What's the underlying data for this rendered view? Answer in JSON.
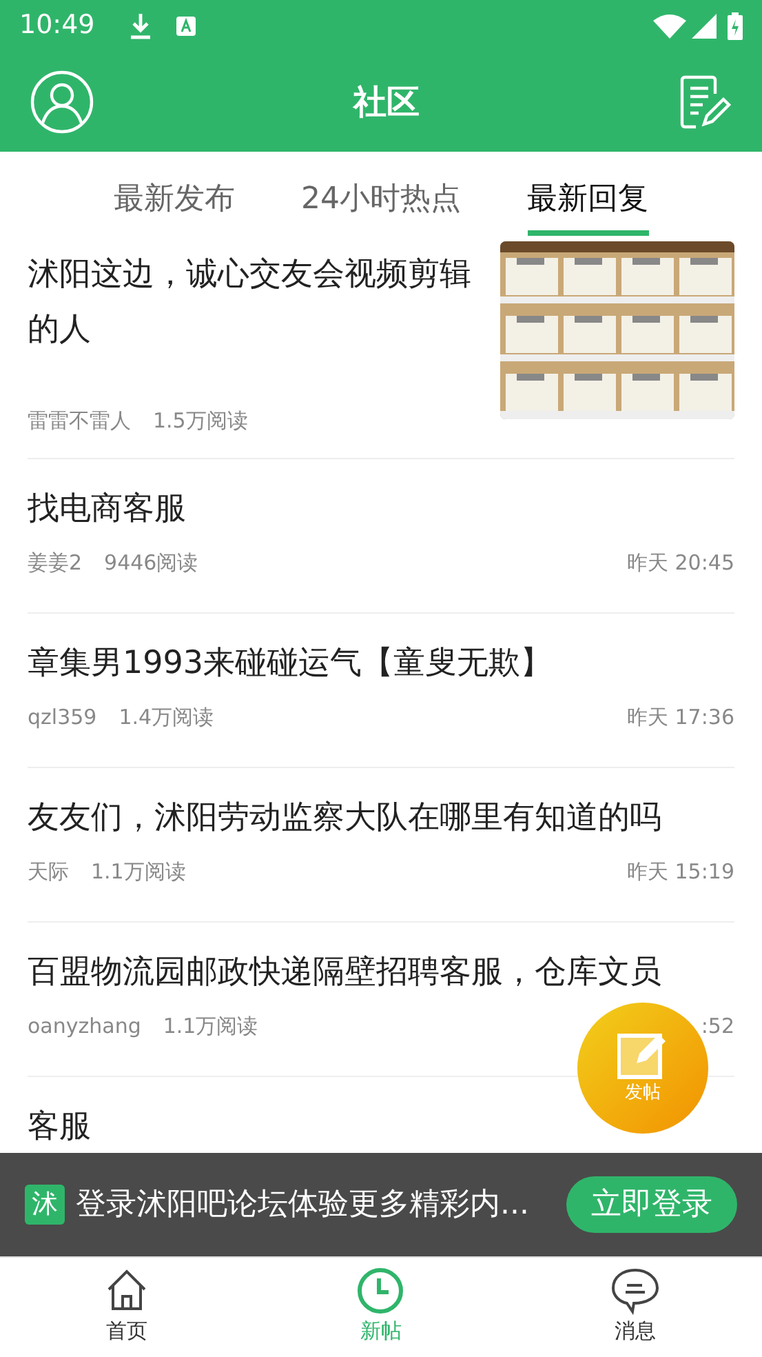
{
  "status_bar": {
    "time": "10:49"
  },
  "header": {
    "title": "社区"
  },
  "tabs": [
    {
      "label": "最新发布",
      "selected": false
    },
    {
      "label": "24小时热点",
      "selected": false
    },
    {
      "label": "最新回复",
      "selected": true
    }
  ],
  "posts": [
    {
      "title": "沭阳这边，诚心交友会视频剪辑的人",
      "author": "雷雷不雷人",
      "reads": "1.5万阅读"
    },
    {
      "title": "找电商客服",
      "author": "姜姜2",
      "reads": "9446阅读",
      "time": "昨天 20:45"
    },
    {
      "title": "章集男1993来碰碰运气【童叟无欺】",
      "author": "qzl359",
      "reads": "1.4万阅读",
      "time": "昨天 17:36"
    },
    {
      "title": "友友们，沭阳劳动监察大队在哪里有知道的吗",
      "author": "天际",
      "reads": "1.1万阅读",
      "time": "昨天 15:19"
    },
    {
      "title": "百盟物流园邮政快递隔壁招聘客服，仓库文员",
      "author": "oanyzhang",
      "reads": "1.1万阅读",
      "time": ":52"
    },
    {
      "title": "客服"
    }
  ],
  "fab": {
    "label": "发帖"
  },
  "login_banner": {
    "logo": "沭",
    "text": "登录沭阳吧论坛体验更多精彩内...",
    "button": "立即登录"
  },
  "bottom_nav": [
    {
      "label": "首页",
      "kind": "home",
      "selected": false
    },
    {
      "label": "新帖",
      "kind": "clock",
      "selected": true
    },
    {
      "label": "消息",
      "kind": "chat",
      "selected": false
    }
  ]
}
